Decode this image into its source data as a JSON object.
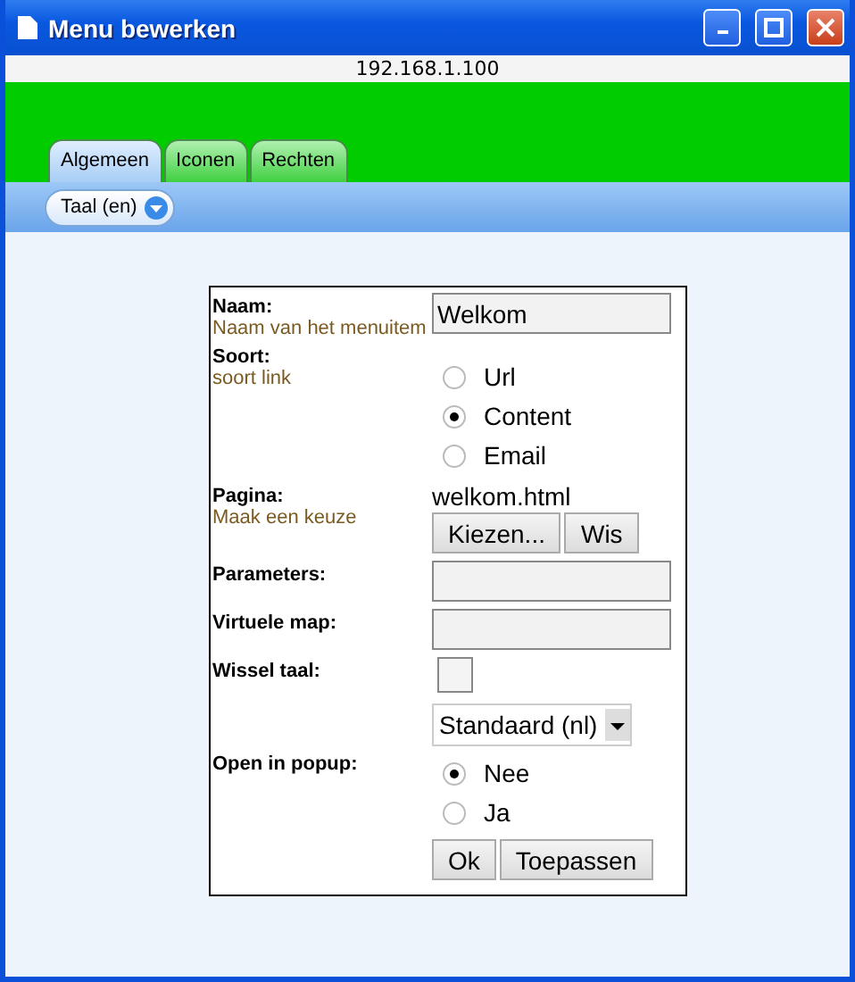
{
  "window": {
    "title": "Menu bewerken",
    "address": "192.168.1.100"
  },
  "tabs": [
    {
      "label": "Algemeen",
      "selected": true
    },
    {
      "label": "Iconen",
      "selected": false
    },
    {
      "label": "Rechten",
      "selected": false
    }
  ],
  "toolbar": {
    "language_button": "Taal (en)"
  },
  "form": {
    "rows": [
      {
        "kind": "text",
        "label": "Naam:",
        "hint": "Naam van het menuitem",
        "value": "Welkom"
      },
      {
        "kind": "radio",
        "label": "Soort:",
        "hint": "soort link",
        "options": [
          {
            "label": "Url",
            "selected": false
          },
          {
            "label": "Content",
            "selected": true
          },
          {
            "label": "Email",
            "selected": false
          }
        ]
      },
      {
        "kind": "page",
        "label": "Pagina:",
        "hint": "Maak een keuze",
        "value": "welkom.html",
        "buttons": [
          "Kiezen...",
          "Wis"
        ]
      },
      {
        "kind": "text",
        "label": "Parameters:"
      },
      {
        "kind": "text",
        "label": "Virtuele map:"
      },
      {
        "kind": "checkbox",
        "label": "Wissel taal:",
        "checked": false,
        "select": "Standaard (nl)"
      },
      {
        "kind": "radio",
        "label": "Open in popup:",
        "options": [
          {
            "label": "Nee",
            "selected": true
          },
          {
            "label": "Ja",
            "selected": false
          }
        ]
      }
    ],
    "buttons": [
      "Ok",
      "Toepassen"
    ]
  }
}
